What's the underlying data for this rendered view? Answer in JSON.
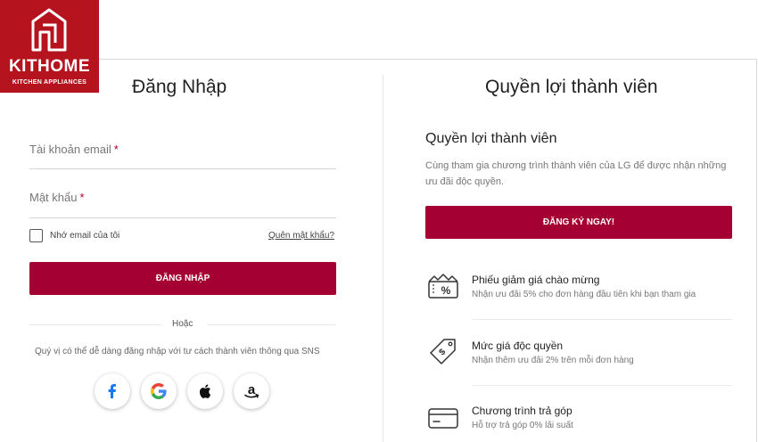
{
  "logo": {
    "brand": "KITHOME",
    "tagline": "KITCHEN APPLIANCES"
  },
  "login": {
    "title": "Đăng Nhập",
    "email_label": "Tài khoản email",
    "password_label": "Mật khẩu",
    "required_mark": "*",
    "remember_label": "Nhớ email của tôi",
    "forgot_label": "Quên mật khẩu?",
    "login_button": "ĐĂNG NHẬP",
    "or_label": "Hoặc",
    "sns_text": "Quý vị có thể dễ dàng đăng nhập với tư cách thành viên thông qua SNS",
    "sns": [
      {
        "name": "facebook",
        "icon": "facebook-icon",
        "color": "#1877f2"
      },
      {
        "name": "google",
        "icon": "google-icon",
        "color": "#4285f4"
      },
      {
        "name": "apple",
        "icon": "apple-icon",
        "color": "#111111"
      },
      {
        "name": "amazon",
        "icon": "amazon-icon",
        "color": "#111111"
      }
    ]
  },
  "benefits": {
    "heading": "Quyền lợi thành viên",
    "subheading": "Quyền lợi thành viên",
    "description": "Cùng tham gia chương trình thành viên của LG để được nhận những ưu đãi độc quyền.",
    "register_button": "ĐĂNG KÝ NGAY!",
    "items": [
      {
        "icon": "coupon-percent-icon",
        "title": "Phiếu giảm giá chào mừng",
        "desc": "Nhận ưu đãi 5% cho đơn hàng đầu tiên khi bạn tham gia"
      },
      {
        "icon": "price-tag-icon",
        "title": "Mức giá độc quyền",
        "desc": "Nhận thêm ưu đãi 2% trên mỗi đơn hàng"
      },
      {
        "icon": "credit-card-icon",
        "title": "Chương trình trả góp",
        "desc": "Hỗ trợ trả góp 0% lãi suất"
      }
    ]
  },
  "colors": {
    "accent": "#a50034",
    "logo_bg": "#b5141f"
  }
}
